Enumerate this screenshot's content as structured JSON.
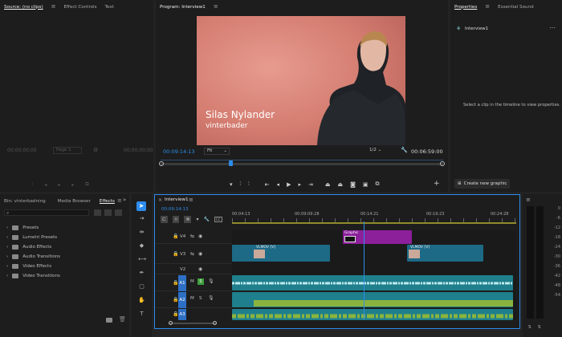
{
  "source": {
    "tabs": [
      "Source: (no clips)",
      "Effect Controls",
      "Text"
    ],
    "tc_left": "00;00;00;00",
    "page": "Page 1",
    "tc_right": "00;00;00;00"
  },
  "program": {
    "title": "Program: Interview1",
    "overlay": {
      "name": "Silas Nylander",
      "role": "vinterbader"
    },
    "tc_current": "00:09:14:13",
    "fit": "Fit",
    "quality": "1/2",
    "tc_total": "00:06:59:00"
  },
  "properties": {
    "tabs": [
      "Properties",
      "Essential Sound"
    ],
    "sequence": "Interview1",
    "message": "Select a clip in the timeline to view properties.",
    "create_button": "Create new graphic"
  },
  "project": {
    "tabs": [
      "Bin: vinterbadning",
      "Media Browser",
      "Effects"
    ],
    "folders": [
      "Presets",
      "Lumetri Presets",
      "Audio Effects",
      "Audio Transitions",
      "Video Effects",
      "Video Transitions"
    ]
  },
  "timeline": {
    "tab": "Interview1",
    "tc": "00:09:14:13",
    "rulers": [
      "00:04:13",
      "00:09:09:28",
      "00:14:21",
      "00:19:23",
      "00:24:28"
    ],
    "tracks": [
      "V4",
      "V3",
      "V2",
      "A1",
      "A2",
      "A3"
    ],
    "clips": {
      "graphic": "Graphic",
      "v3a": "VLMOV [V]",
      "v3b": "VLMOV [V]",
      "fx": "fx"
    }
  },
  "meter": {
    "labels": [
      "0",
      "-6",
      "-12",
      "-18",
      "-24",
      "-30",
      "-36",
      "-42",
      "-48",
      "-54"
    ],
    "solo": "S",
    "solo2": "S"
  },
  "colors": {
    "accent": "#2d8ceb",
    "video_clip": "#1d6a86",
    "audio_clip": "#1f7f8c",
    "graphic_clip": "#8c1f9a",
    "audio_green": "#8ab43e"
  }
}
